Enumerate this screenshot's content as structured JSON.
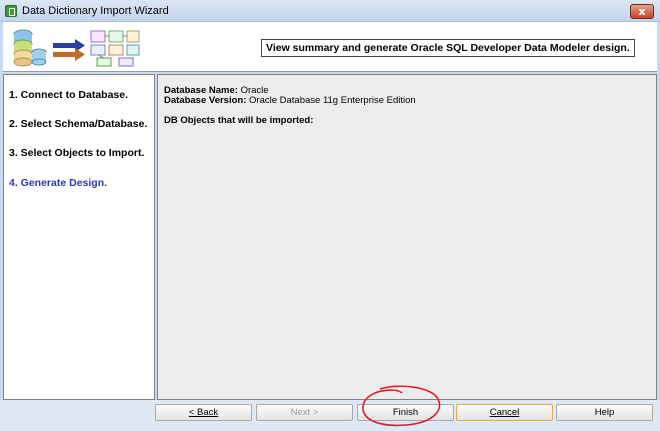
{
  "window": {
    "title": "Data Dictionary Import Wizard",
    "close_glyph": "x"
  },
  "header": {
    "title": "View summary and generate Oracle SQL Developer Data Modeler design."
  },
  "steps": [
    {
      "label": "1. Connect to Database.",
      "active": false
    },
    {
      "label": "2. Select Schema/Database.",
      "active": false
    },
    {
      "label": "3. Select Objects to Import.",
      "active": false
    },
    {
      "label": "4. Generate Design.",
      "active": true
    }
  ],
  "summary": {
    "db_name_label": "Database Name:",
    "db_name_value": "Oracle",
    "db_version_label": "Database Version:",
    "db_version_value": "Oracle Database 11g Enterprise Edition",
    "objects_label": "DB Objects that will be imported:"
  },
  "buttons": {
    "back": "< Back",
    "next": "Next >",
    "finish": "Finish",
    "cancel": "Cancel",
    "help": "Help"
  },
  "colors": {
    "active_step": "#2a3aa8",
    "annotation": "#d8202a"
  }
}
